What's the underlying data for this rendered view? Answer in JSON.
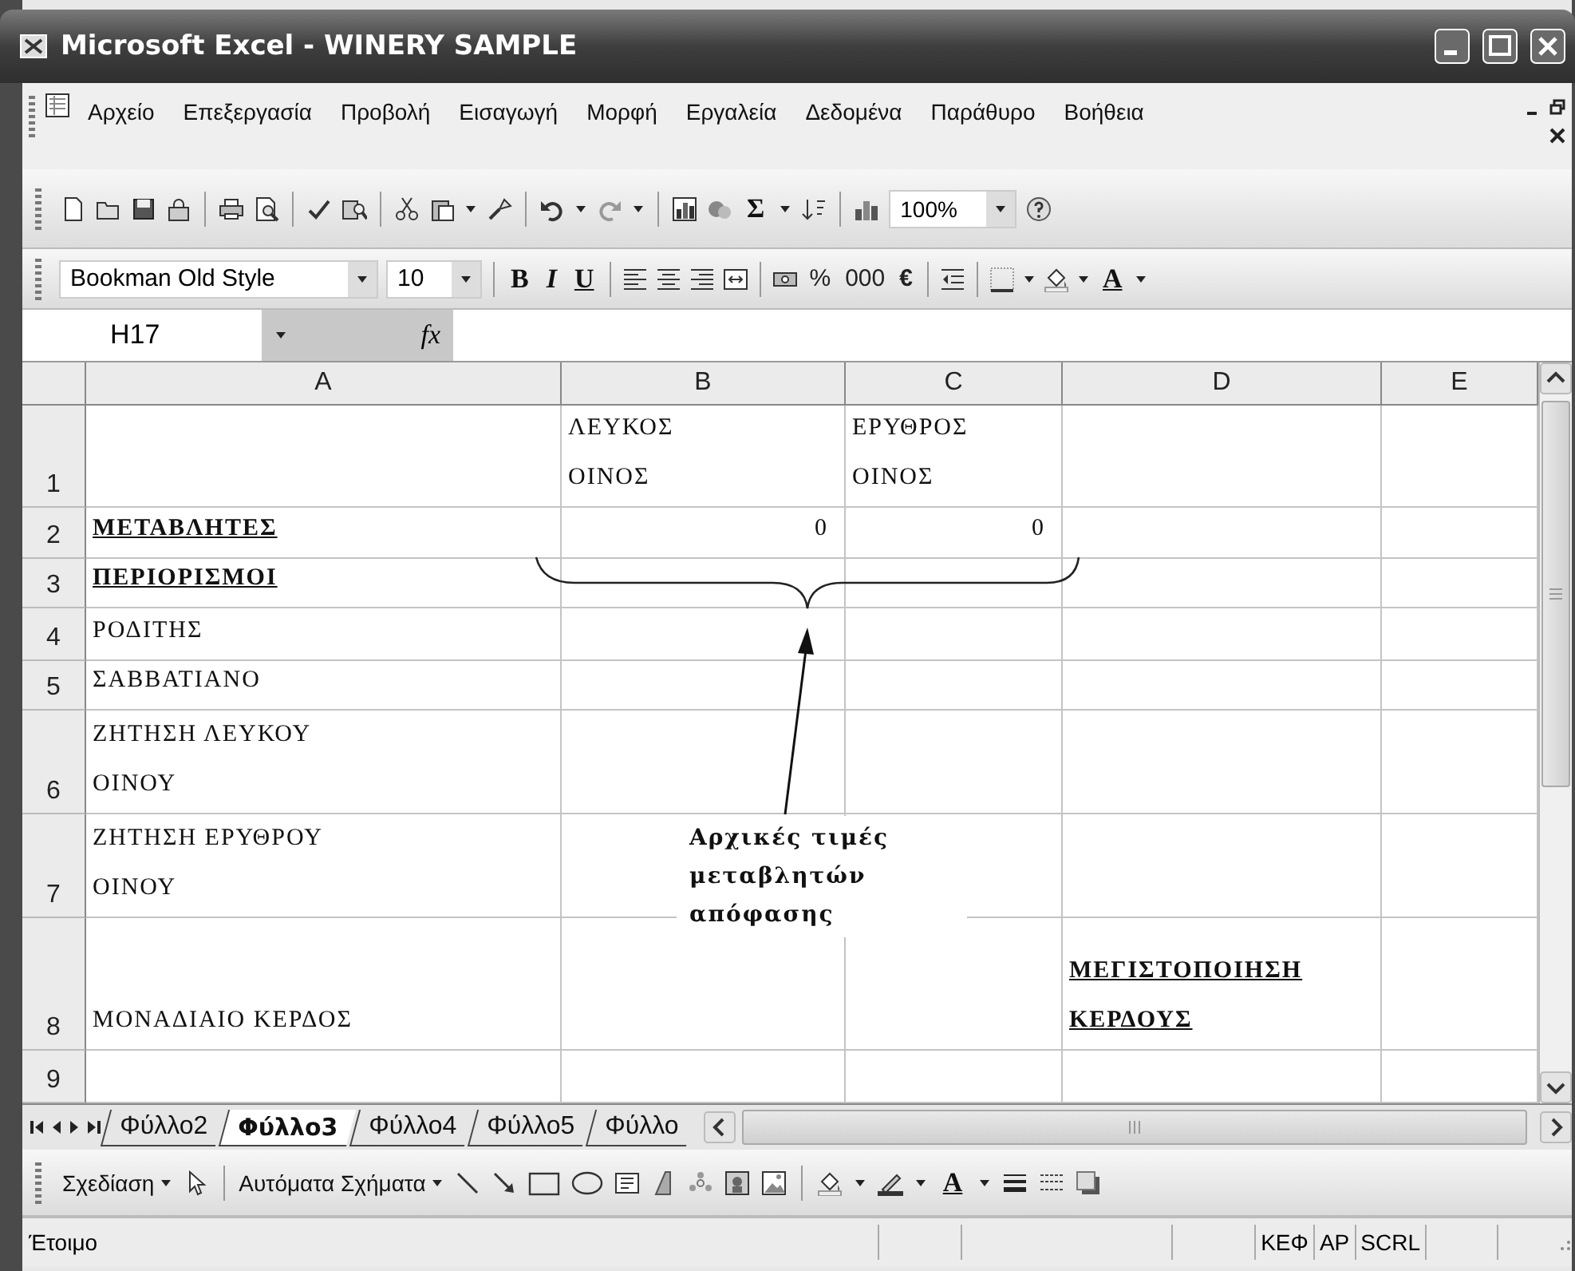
{
  "window": {
    "title": "Microsoft Excel - WINERY SAMPLE"
  },
  "menu": [
    "Αρχείο",
    "Επεξεργασία",
    "Προβολή",
    "Εισαγωγή",
    "Μορφή",
    "Εργαλεία",
    "Δεδομένα",
    "Παράθυρο",
    "Βοήθεια"
  ],
  "standard_toolbar": {
    "sum": "Σ",
    "zoom": "100%"
  },
  "formatting_toolbar": {
    "font": "Bookman Old Style",
    "size": "10",
    "bold": "B",
    "italic": "I",
    "underline": "U",
    "percent": "%",
    "thousands": "000",
    "euro": "€",
    "font_color": "A"
  },
  "formula_bar": {
    "name_box": "H17",
    "function_label": "fx"
  },
  "columns": [
    "A",
    "B",
    "C",
    "D",
    "E"
  ],
  "rows": [
    {
      "header": "1",
      "cells": {
        "B": {
          "kind": "text",
          "lines": [
            "ΛΕΥΚΟΣ",
            "ΟΙΝΟΣ"
          ]
        },
        "C": {
          "kind": "text",
          "lines": [
            "ΕΡΥΘΡΟΣ",
            "ΟΙΝΟΣ"
          ]
        }
      }
    },
    {
      "header": "2",
      "cells": {
        "A": {
          "kind": "heading",
          "lines": [
            "ΜΕΤΑΒΛΗΤΕΣ"
          ]
        },
        "B": {
          "kind": "number",
          "lines": [
            "0"
          ]
        },
        "C": {
          "kind": "number",
          "lines": [
            "0"
          ]
        }
      }
    },
    {
      "header": "3",
      "cells": {
        "A": {
          "kind": "heading",
          "lines": [
            "ΠΕΡΙΟΡΙΣΜΟΙ"
          ]
        }
      }
    },
    {
      "header": "4",
      "cells": {
        "A": {
          "kind": "text",
          "lines": [
            "ΡΟΔΙΤΗΣ"
          ]
        }
      }
    },
    {
      "header": "5",
      "cells": {
        "A": {
          "kind": "text",
          "lines": [
            "ΣΑΒΒΑΤΙΑΝΟ"
          ]
        }
      }
    },
    {
      "header": "6",
      "cells": {
        "A": {
          "kind": "text",
          "lines": [
            "ΖΗΤΗΣΗ ΛΕΥΚΟΥ",
            "ΟΙΝΟΥ"
          ]
        }
      }
    },
    {
      "header": "7",
      "cells": {
        "A": {
          "kind": "text",
          "lines": [
            "ΖΗΤΗΣΗ ΕΡΥΘΡΟΥ",
            "ΟΙΝΟΥ"
          ]
        }
      }
    },
    {
      "header": "8",
      "cells": {
        "A": {
          "kind": "text",
          "lines": [
            "ΜΟΝΑΔΙΑΙΟ ΚΕΡΔΟΣ"
          ]
        },
        "D": {
          "kind": "heading",
          "lines": [
            "ΜΕΓΙΣΤΟΠΟΙΗΣΗ",
            "ΚΕΡΔΟΥΣ"
          ]
        }
      }
    },
    {
      "header": "9",
      "cells": {}
    }
  ],
  "annotation": {
    "lines": [
      "Αρχικές τιμές",
      "μεταβλητών",
      "απόφασης"
    ]
  },
  "sheet_tabs": [
    {
      "label": "Φύλλο2",
      "selected": false
    },
    {
      "label": "Φύλλο3",
      "selected": true
    },
    {
      "label": "Φύλλο4",
      "selected": false
    },
    {
      "label": "Φύλλο5",
      "selected": false
    },
    {
      "label": "Φύλλο",
      "selected": false
    }
  ],
  "drawing_toolbar": {
    "draw_menu": "Σχεδίαση",
    "autoshapes_menu": "Αυτόματα Σχήματα",
    "font_color": "A"
  },
  "status_bar": {
    "message": "Έτοιμο",
    "indicators": [
      "ΚΕΦ",
      "ΑΡ",
      "SCRL"
    ]
  }
}
